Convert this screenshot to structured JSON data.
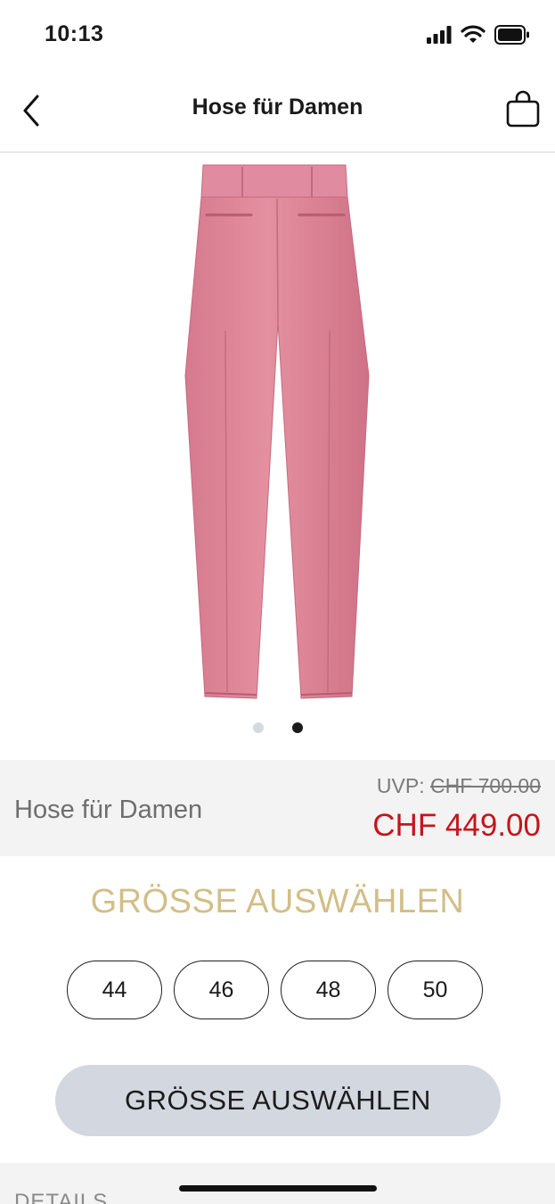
{
  "status": {
    "time": "10:13"
  },
  "nav": {
    "title": "Hose für Damen"
  },
  "gallery": {
    "pages": 2,
    "active_page": 2,
    "product_color": "#de8599"
  },
  "product": {
    "name": "Hose für Damen",
    "uvp_label": "UVP:",
    "uvp_price": "CHF 700.00",
    "sale_price": "CHF 449.00"
  },
  "size_section": {
    "heading": "GRÖSSE AUSWÄHLEN",
    "sizes": [
      "44",
      "46",
      "48",
      "50"
    ]
  },
  "cta": {
    "label": "GRÖSSE AUSWÄHLEN"
  },
  "details": {
    "label": "DETAILS"
  },
  "colors": {
    "accent_gold": "#d2be87",
    "sale_red": "#c4161c",
    "cta_bg": "#d3d7df"
  }
}
